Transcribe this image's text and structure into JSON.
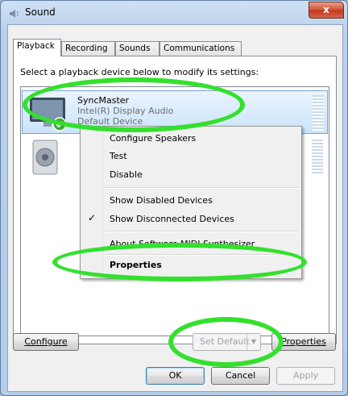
{
  "window": {
    "title": "Sound",
    "close_symbol": "x"
  },
  "tabs": [
    {
      "label": "Playback",
      "active": true
    },
    {
      "label": "Recording",
      "active": false
    },
    {
      "label": "Sounds",
      "active": false
    },
    {
      "label": "Communications",
      "active": false
    }
  ],
  "instruction": "Select a playback device below to modify its settings:",
  "devices": [
    {
      "name": "SyncMaster",
      "description": "Intel(R) Display Audio",
      "status": "Default Device",
      "icon": "monitor-icon",
      "default": true,
      "selected": true
    },
    {
      "name": "",
      "description": "",
      "status": "",
      "icon": "speaker-icon",
      "default": false,
      "selected": false
    }
  ],
  "context_menu": {
    "items": [
      {
        "label": "Configure Speakers",
        "checked": false,
        "bold": false
      },
      {
        "label": "Test",
        "checked": false,
        "bold": false
      },
      {
        "label": "Disable",
        "checked": false,
        "bold": false
      },
      {
        "label": "Show Disabled Devices",
        "checked": false,
        "bold": false
      },
      {
        "label": "Show Disconnected Devices",
        "checked": true,
        "bold": false
      },
      {
        "label": "About Software MIDI Synthesizer",
        "checked": false,
        "bold": false
      },
      {
        "label": "Properties",
        "checked": false,
        "bold": true
      }
    ],
    "check_symbol": "✓"
  },
  "buttons": {
    "configure": "Configure",
    "set_default": "Set Default",
    "properties": "Properties",
    "ok": "OK",
    "cancel": "Cancel",
    "apply": "Apply"
  },
  "highlight_color": "#33e02d"
}
